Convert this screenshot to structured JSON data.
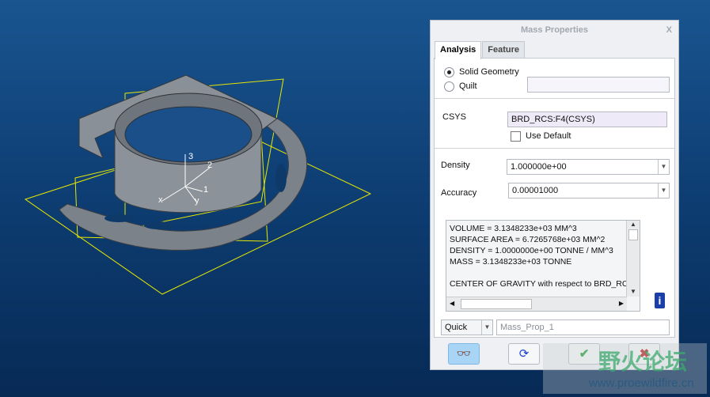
{
  "dialog": {
    "title": "Mass Properties",
    "close": "X",
    "tabs": [
      {
        "label": "Analysis",
        "active": true
      },
      {
        "label": "Feature",
        "active": false
      }
    ],
    "geometry": {
      "options": [
        "Solid Geometry",
        "Quilt"
      ],
      "selected": "Solid Geometry",
      "quilt_value": ""
    },
    "csys": {
      "label": "CSYS",
      "value": "BRD_RCS:F4(CSYS)",
      "use_default_label": "Use Default",
      "use_default": false
    },
    "density": {
      "label": "Density",
      "value": "1.000000e+00"
    },
    "accuracy": {
      "label": "Accuracy",
      "value": "0.00001000"
    },
    "output": [
      "VOLUME =  3.1348233e+03  MM^3",
      "SURFACE AREA =  6.7265768e+03  MM^2",
      "DENSITY =  1.0000000e+00 TONNE / MM^3",
      "MASS =  3.1348233e+03 TONNE",
      "",
      "CENTER OF GRAVITY with respect to BRD_RCS"
    ],
    "mode": "Quick",
    "name_value": "Mass_Prop_1",
    "buttons": {
      "preview": "glasses-icon",
      "repeat": "refresh-icon",
      "ok": "check-icon",
      "cancel": "x-icon"
    }
  },
  "model": {
    "axis_labels": [
      "3",
      "2",
      "1",
      "x",
      "y"
    ]
  },
  "watermark": {
    "cn": "野火论坛",
    "url": "www.proewildfire.cn"
  }
}
